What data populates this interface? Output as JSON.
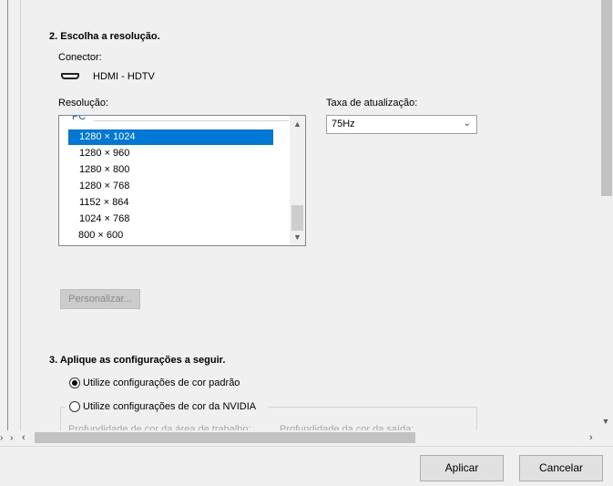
{
  "section2": {
    "heading": "2. Escolha a resolução.",
    "connector_label": "Conector:",
    "connector_value": "HDMI - HDTV",
    "resolution_label": "Resolução:",
    "refresh_label": "Taxa de atualização:",
    "group_label": "PC",
    "resolutions": [
      "1280 × 1024",
      "1280 × 960",
      "1280 × 800",
      "1280 × 768",
      "1152 × 864",
      "1024 × 768",
      "800 × 600"
    ],
    "selected_resolution": "1280 × 1024",
    "refresh_value": "75Hz",
    "customize_button": "Personalizar..."
  },
  "section3": {
    "heading": "3. Aplique as configurações a seguir.",
    "radio_default": "Utilize configurações de cor padrão",
    "radio_nvidia": "Utilize configurações de cor da NVIDIA",
    "desktop_depth_label": "Profundidade de cor da área de trabalho:",
    "output_depth_label": "Profundidade da cor da saída:"
  },
  "footer": {
    "apply_button": "Aplicar",
    "cancel_button": "Cancelar"
  },
  "colors": {
    "selection": "#0078d7",
    "group_label": "#0066cc"
  }
}
